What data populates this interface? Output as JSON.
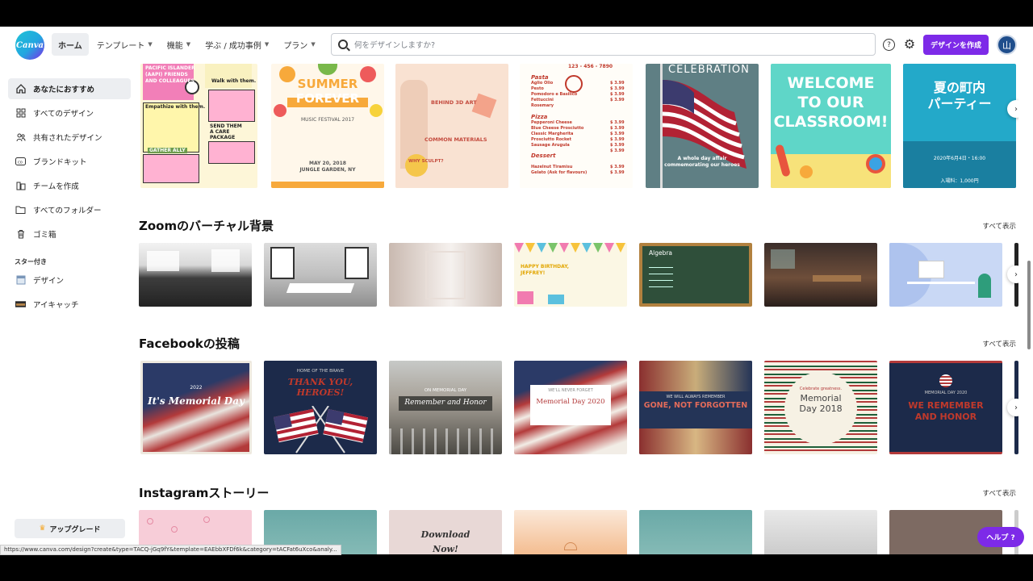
{
  "topbar": {
    "logo_text": "Canva",
    "nav": [
      {
        "label": "ホーム",
        "has_chevron": false,
        "active": true
      },
      {
        "label": "テンプレート",
        "has_chevron": true
      },
      {
        "label": "機能",
        "has_chevron": true
      },
      {
        "label": "学ぶ / 成功事例",
        "has_chevron": true
      },
      {
        "label": "プラン",
        "has_chevron": true
      }
    ],
    "search_placeholder": "何をデザインしますか?",
    "create_button": "デザインを作成",
    "avatar_initial": "山",
    "accent_color": "#7d2ae8"
  },
  "sidebar": {
    "items": [
      {
        "label": "あなたにおすすめ",
        "icon": "home-icon",
        "active": true
      },
      {
        "label": "すべてのデザイン",
        "icon": "grid-icon"
      },
      {
        "label": "共有されたデザイン",
        "icon": "people-icon"
      },
      {
        "label": "ブランドキット",
        "icon": "brand-icon"
      },
      {
        "label": "チームを作成",
        "icon": "team-icon"
      },
      {
        "label": "すべてのフォルダー",
        "icon": "folder-icon"
      },
      {
        "label": "ゴミ箱",
        "icon": "trash-icon"
      }
    ],
    "starred_heading": "スター付き",
    "starred": [
      {
        "label": "デザイン",
        "icon": "design-doc-icon"
      },
      {
        "label": "アイキャッチ",
        "icon": "eyecatch-thumb-icon"
      }
    ],
    "upgrade_label": "アップグレード"
  },
  "top_templates": {
    "cards": [
      {
        "lines": [
          "PACIFIC ISLANDER",
          "(AAPI) FRIENDS",
          "AND COLLEAGUES",
          "Walk with them.",
          "Empathize with them.",
          "SEND THEM",
          "A CARE",
          "PACKAGE",
          "GATHER ALLY"
        ]
      },
      {
        "lines": [
          "SUMMER",
          "FOREVER",
          "MUSIC FESTIVAL 2017",
          "MAY 20, 2018",
          "JUNGLE GARDEN, NY"
        ]
      },
      {
        "lines": [
          "BEHIND 3D ART",
          "COMMON MATERIALS",
          "WHY SCULPT?"
        ]
      },
      {
        "lines": [
          "123 - 456 - 7890",
          "Pasta",
          "Aglio Olio",
          "Pesto",
          "Pomodoro e Basilico",
          "Fettuccini",
          "Rosemary",
          "Pizza",
          "Pepperoni Cheese",
          "Blue Cheese Prosciutto",
          "Classic Margherita",
          "Prosciutto Rocket",
          "Sausage Arugula",
          "Dessert",
          "Hazelnut Tiramisu",
          "Gelato (Ask for flavours)"
        ],
        "prices": [
          "$ 3.99",
          "$ 3.99",
          "$ 3.99",
          "$ 3.99",
          "$ 3.99",
          "$ 3.99",
          "$ 3.99",
          "$ 3.99",
          "$ 3.99",
          "$ 3.99",
          "$ 3.99",
          "$ 3.99"
        ]
      },
      {
        "lines": [
          "CELEBRATION",
          "A whole day affair",
          "commemorating our heroes"
        ]
      },
      {
        "lines": [
          "WELCOME",
          "TO OUR",
          "CLASSROOM!"
        ]
      },
      {
        "lines": [
          "夏の町内",
          "パーティー",
          "2020年6月4日・16:00",
          "入場料：1,000円"
        ]
      }
    ]
  },
  "sections": [
    {
      "title": "Zoomのバーチャル背景",
      "see_all": "すべて表示",
      "cards": [
        {
          "caption": ""
        },
        {
          "caption": ""
        },
        {
          "caption": ""
        },
        {
          "caption": "HAPPY BIRTHDAY, JEFFREY!"
        },
        {
          "caption": "Algebra"
        },
        {
          "caption": ""
        },
        {
          "caption": ""
        }
      ]
    },
    {
      "title": "Facebookの投稿",
      "see_all": "すべて表示",
      "cards": [
        {
          "caption": "It's Memorial Day",
          "sub": "2022"
        },
        {
          "caption": "THANK YOU, HEROES!",
          "sub": "HOME OF THE BRAVE"
        },
        {
          "caption": "Remember and Honor",
          "sub": "ON MEMORIAL DAY"
        },
        {
          "caption": "Memorial Day 2020",
          "sub": "WE'LL NEVER FORGET"
        },
        {
          "caption": "GONE, NOT FORGOTTEN",
          "sub": "WE WILL ALWAYS REMEMBER"
        },
        {
          "caption": "Memorial Day 2018",
          "sub": "Celebrate greatness."
        },
        {
          "caption": "WE REMEMBER AND HONOR",
          "sub": "MEMORIAL DAY 2020"
        }
      ]
    },
    {
      "title": "Instagramストーリー",
      "see_all": "すべて表示",
      "cards": [
        {
          "caption": ""
        },
        {
          "caption": ""
        },
        {
          "caption": "Download Now!"
        },
        {
          "caption": ""
        },
        {
          "caption": ""
        },
        {
          "caption": ""
        },
        {
          "caption": ""
        }
      ]
    }
  ],
  "help_button": "ヘルプ ?",
  "status_url": "https://www.canva.com/design?create&type=TACQ-jGq9fY&template=EAEbbXFDf6k&category=tACFat6uXco&analy..."
}
